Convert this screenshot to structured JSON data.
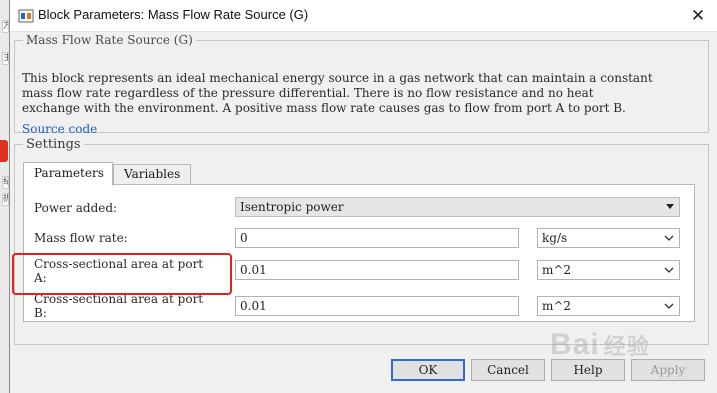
{
  "window": {
    "title": "Block Parameters: Mass Flow Rate Source (G)",
    "close_glyph": "✕",
    "app_icon": "simulink-block-icon"
  },
  "background": {
    "left_marks": [
      "方",
      "主",
      "纪",
      "拆",
      "主"
    ]
  },
  "block": {
    "group_title": "Mass Flow Rate Source (G)",
    "description_lines": [
      "This block represents an ideal mechanical energy source in a gas network that can maintain a constant",
      "mass flow rate regardless of the pressure differential. There is no flow resistance and no heat",
      "exchange with the environment. A positive mass flow rate causes gas to flow from port A to port B."
    ],
    "source_link": "Source code"
  },
  "settings": {
    "group_title": "Settings",
    "tabs": [
      {
        "label": "Parameters",
        "active": true
      },
      {
        "label": "Variables",
        "active": false
      }
    ],
    "rows": [
      {
        "label_lines": [
          "Power added:"
        ],
        "value": "Isentropic power"
      },
      {
        "label_lines": [
          "Mass flow rate:"
        ],
        "value": "0",
        "unit": "kg/s"
      },
      {
        "label_lines": [
          "Cross-sectional area at port",
          "A:"
        ],
        "value": "0.01",
        "unit": "m^2"
      },
      {
        "label_lines": [
          "Cross-sectional area at port",
          "B:"
        ],
        "value": "0.01",
        "unit": "m^2"
      }
    ]
  },
  "buttons": {
    "ok": "OK",
    "cancel": "Cancel",
    "help": "Help",
    "apply": "Apply"
  },
  "watermark": {
    "brand": "Bai",
    "brand_suffix": "经验"
  },
  "colors": {
    "highlight": "#e0241a",
    "link": "#1e5bc6",
    "ok_border": "#2f6ad8"
  }
}
